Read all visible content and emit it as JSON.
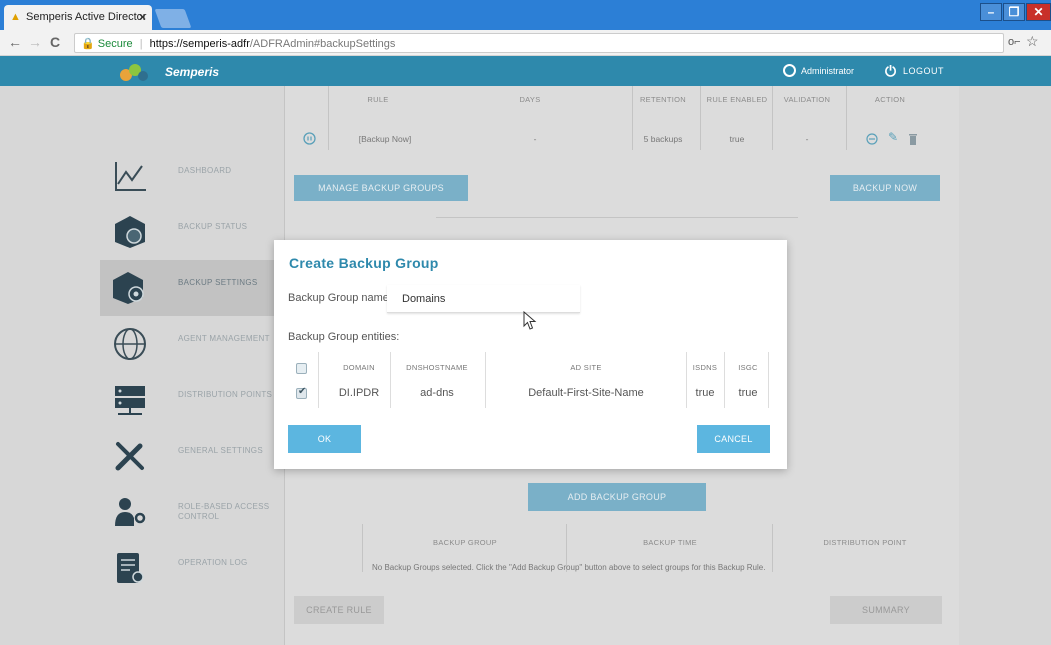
{
  "browser": {
    "tab_title": "Semperis Active Director",
    "tab_close": "×",
    "nav": {
      "back": "←",
      "forward": "→",
      "reload": "C"
    },
    "secure_label": "Secure",
    "url_scheme_host": "https://semperis-adfr",
    "url_path": "/ADFRAdmin#backupSettings",
    "window": {
      "minimize": "–",
      "restore": "❐",
      "close": "✕"
    }
  },
  "app": {
    "brand": "Semperis",
    "user": "Administrator",
    "logout_label": "LOGOUT"
  },
  "sidebar": {
    "items": [
      {
        "label": "DASHBOARD",
        "icon": "dashboard-chart-icon"
      },
      {
        "label": "BACKUP STATUS",
        "icon": "backup-status-icon"
      },
      {
        "label": "BACKUP SETTINGS",
        "icon": "backup-settings-icon",
        "active": true
      },
      {
        "label": "AGENT MANAGEMENT",
        "icon": "globe-icon"
      },
      {
        "label": "DISTRIBUTION POINTS",
        "icon": "server-icon"
      },
      {
        "label": "GENERAL SETTINGS",
        "icon": "tools-icon"
      },
      {
        "label": "ROLE-BASED ACCESS CONTROL",
        "icon": "role-key-icon"
      },
      {
        "label": "OPERATION LOG",
        "icon": "operation-log-icon"
      }
    ]
  },
  "rules_table": {
    "headers": [
      "RULE",
      "DAYS",
      "RETENTION",
      "RULE ENABLED",
      "VALIDATION",
      "ACTION"
    ],
    "row": {
      "rule": "[Backup Now]",
      "days": "-",
      "retention": "5 backups",
      "enabled": "true",
      "validation": "-"
    }
  },
  "buttons": {
    "manage_groups": "MANAGE BACKUP GROUPS",
    "backup_now": "BACKUP NOW",
    "add_group": "ADD BACKUP GROUP",
    "create_rule": "CREATE RULE",
    "summary": "SUMMARY"
  },
  "groups_table": {
    "headers": [
      "BACKUP GROUP",
      "BACKUP TIME",
      "DISTRIBUTION POINT"
    ],
    "empty_message": "No Backup Groups selected. Click the \"Add Backup Group\" button above to select groups for this Backup Rule."
  },
  "modal": {
    "title": "Create Backup Group",
    "name_label": "Backup Group name:",
    "name_value": "Domains",
    "entities_label": "Backup Group entities:",
    "headers": [
      "DOMAIN",
      "DNSHOSTNAME",
      "AD SITE",
      "ISDNS",
      "ISGC"
    ],
    "rows": [
      {
        "domain": "DI.IPDR",
        "dnshostname": "ad-dns",
        "ad_site": "Default-First-Site-Name",
        "isdns": "true",
        "isgc": "true",
        "checked": true
      }
    ],
    "ok": "OK",
    "cancel": "CANCEL"
  },
  "colors": {
    "app_header": "#2e89ac",
    "accent": "#2e89ac",
    "modal_button": "#5cb6e0",
    "titlebar": "#2c7fd6"
  }
}
